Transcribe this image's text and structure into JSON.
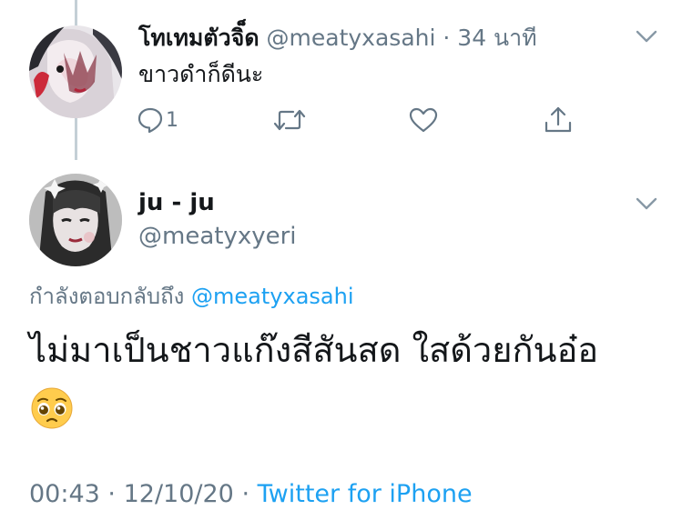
{
  "parent_tweet": {
    "display_name": "โทเทมตัวจิ็ด",
    "handle": "@meatyxasahi",
    "separator": "·",
    "time_ago": "34 นาที",
    "text": "ขาวดำก็ดีนะ",
    "actions": {
      "reply_icon": "reply-icon",
      "reply_count": "1",
      "retweet_icon": "retweet-icon",
      "like_icon": "heart-icon",
      "share_icon": "share-icon"
    }
  },
  "main_tweet": {
    "display_name": "ju - ju",
    "handle": "@meatyxyeri",
    "replying_prefix": "กำลังตอบกลับถึง",
    "replying_to": "@meatyxasahi",
    "text": "ไม่มาเป็นชาวแก๊งสีสันสด ใสด้วยกันอ๋อ",
    "emoji": "pleading-face-emoji",
    "time": "00:43",
    "date": "12/10/20",
    "source": "Twitter for iPhone",
    "separator": "·"
  },
  "colors": {
    "text_primary": "#14171a",
    "text_secondary": "#657786",
    "link": "#1da1f2",
    "thread_line": "#c4cfd6"
  }
}
